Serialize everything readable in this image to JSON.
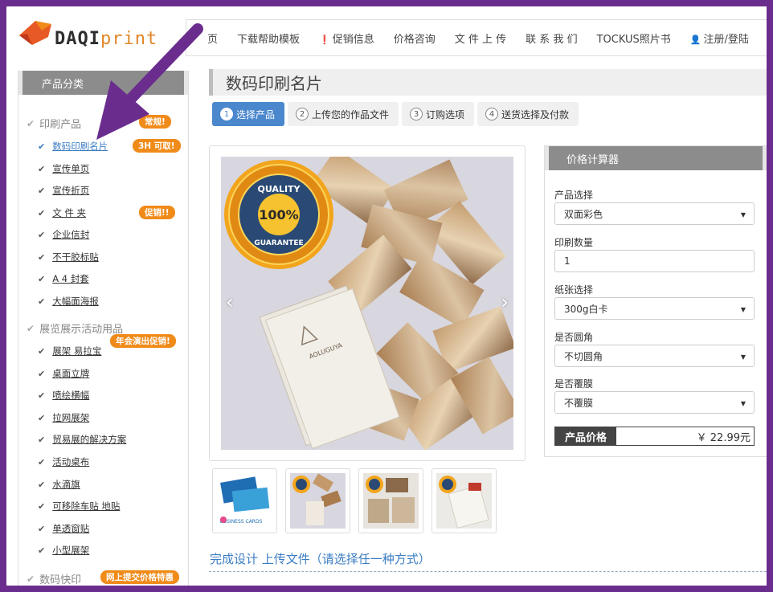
{
  "header": {
    "logo_daqi": "DAQI",
    "logo_print": "print",
    "nav": [
      {
        "label": "页"
      },
      {
        "label": "下载帮助模板"
      },
      {
        "label": "促销信息"
      },
      {
        "label": "价格咨询"
      },
      {
        "label": "文 件 上 传"
      },
      {
        "label": "联 系 我 们"
      },
      {
        "label": "TOCKUS照片书"
      },
      {
        "label": "注册/登陆"
      }
    ]
  },
  "sidebar": {
    "title": "产品分类",
    "categories": [
      {
        "label": "印刷产品",
        "badge": "常规!"
      },
      {
        "label": "展览展示活动用品",
        "badge": "年会演出促销!"
      },
      {
        "label": "数码快印",
        "badge": "网上提交价格特惠"
      }
    ],
    "items_print": [
      {
        "label": "数码印刷名片",
        "badge": "3H 可取!"
      },
      {
        "label": "宣传单页"
      },
      {
        "label": "宣传折页"
      },
      {
        "label": "文 件 夹",
        "badge": "促销!!"
      },
      {
        "label": "企业信封"
      },
      {
        "label": "不干胶标贴"
      },
      {
        "label": "A 4 封套"
      },
      {
        "label": "大幅面海报"
      }
    ],
    "items_expo": [
      {
        "label": "展架 易拉宝"
      },
      {
        "label": "桌面立牌"
      },
      {
        "label": "喷绘横幅"
      },
      {
        "label": "拉网展架"
      },
      {
        "label": "贸易展的解决方案"
      },
      {
        "label": "活动桌布"
      },
      {
        "label": "水滴旗"
      },
      {
        "label": "可移除车贴 地贴"
      },
      {
        "label": "单透窗贴"
      },
      {
        "label": "小型展架"
      }
    ]
  },
  "main": {
    "title": "数码印刷名片",
    "steps": [
      {
        "num": "1",
        "label": "选择产品"
      },
      {
        "num": "2",
        "label": "上传您的作品文件"
      },
      {
        "num": "3",
        "label": "订购选项"
      },
      {
        "num": "4",
        "label": "送货选择及付款"
      }
    ],
    "seal": {
      "top": "QUALITY",
      "center": "100%",
      "bottom": "GUARANTEE"
    },
    "card_brand": "AOLUGUYA",
    "thumb1_text": "BUSINESS CARDS",
    "section_title": "完成设计 上传文件（请选择任一种方式）"
  },
  "calculator": {
    "title": "价格计算器",
    "product_label": "产品选择",
    "product_value": "双面彩色",
    "qty_label": "印刷数量",
    "qty_value": "1",
    "paper_label": "纸张选择",
    "paper_value": "300g白卡",
    "corner_label": "是否圆角",
    "corner_value": "不切圆角",
    "laminate_label": "是否覆膜",
    "laminate_value": "不覆膜",
    "price_label": "产品价格",
    "price_value": "￥ 22.99元"
  },
  "colors": {
    "frame": "#6a2d8e",
    "accent_blue": "#4a87cc",
    "badge_orange": "#f08b1a",
    "panel_gray": "#8c8c8c"
  }
}
